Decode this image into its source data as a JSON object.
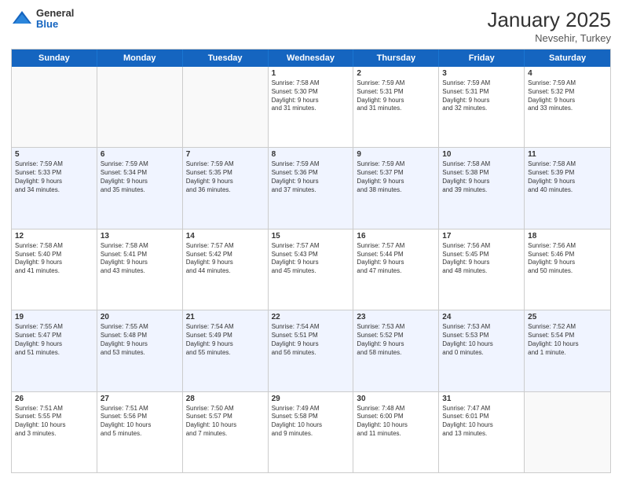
{
  "header": {
    "logo_general": "General",
    "logo_blue": "Blue",
    "month": "January 2025",
    "location": "Nevsehir, Turkey"
  },
  "days_of_week": [
    "Sunday",
    "Monday",
    "Tuesday",
    "Wednesday",
    "Thursday",
    "Friday",
    "Saturday"
  ],
  "weeks": [
    [
      {
        "day": "",
        "text": ""
      },
      {
        "day": "",
        "text": ""
      },
      {
        "day": "",
        "text": ""
      },
      {
        "day": "1",
        "text": "Sunrise: 7:58 AM\nSunset: 5:30 PM\nDaylight: 9 hours\nand 31 minutes."
      },
      {
        "day": "2",
        "text": "Sunrise: 7:59 AM\nSunset: 5:31 PM\nDaylight: 9 hours\nand 31 minutes."
      },
      {
        "day": "3",
        "text": "Sunrise: 7:59 AM\nSunset: 5:31 PM\nDaylight: 9 hours\nand 32 minutes."
      },
      {
        "day": "4",
        "text": "Sunrise: 7:59 AM\nSunset: 5:32 PM\nDaylight: 9 hours\nand 33 minutes."
      }
    ],
    [
      {
        "day": "5",
        "text": "Sunrise: 7:59 AM\nSunset: 5:33 PM\nDaylight: 9 hours\nand 34 minutes."
      },
      {
        "day": "6",
        "text": "Sunrise: 7:59 AM\nSunset: 5:34 PM\nDaylight: 9 hours\nand 35 minutes."
      },
      {
        "day": "7",
        "text": "Sunrise: 7:59 AM\nSunset: 5:35 PM\nDaylight: 9 hours\nand 36 minutes."
      },
      {
        "day": "8",
        "text": "Sunrise: 7:59 AM\nSunset: 5:36 PM\nDaylight: 9 hours\nand 37 minutes."
      },
      {
        "day": "9",
        "text": "Sunrise: 7:59 AM\nSunset: 5:37 PM\nDaylight: 9 hours\nand 38 minutes."
      },
      {
        "day": "10",
        "text": "Sunrise: 7:58 AM\nSunset: 5:38 PM\nDaylight: 9 hours\nand 39 minutes."
      },
      {
        "day": "11",
        "text": "Sunrise: 7:58 AM\nSunset: 5:39 PM\nDaylight: 9 hours\nand 40 minutes."
      }
    ],
    [
      {
        "day": "12",
        "text": "Sunrise: 7:58 AM\nSunset: 5:40 PM\nDaylight: 9 hours\nand 41 minutes."
      },
      {
        "day": "13",
        "text": "Sunrise: 7:58 AM\nSunset: 5:41 PM\nDaylight: 9 hours\nand 43 minutes."
      },
      {
        "day": "14",
        "text": "Sunrise: 7:57 AM\nSunset: 5:42 PM\nDaylight: 9 hours\nand 44 minutes."
      },
      {
        "day": "15",
        "text": "Sunrise: 7:57 AM\nSunset: 5:43 PM\nDaylight: 9 hours\nand 45 minutes."
      },
      {
        "day": "16",
        "text": "Sunrise: 7:57 AM\nSunset: 5:44 PM\nDaylight: 9 hours\nand 47 minutes."
      },
      {
        "day": "17",
        "text": "Sunrise: 7:56 AM\nSunset: 5:45 PM\nDaylight: 9 hours\nand 48 minutes."
      },
      {
        "day": "18",
        "text": "Sunrise: 7:56 AM\nSunset: 5:46 PM\nDaylight: 9 hours\nand 50 minutes."
      }
    ],
    [
      {
        "day": "19",
        "text": "Sunrise: 7:55 AM\nSunset: 5:47 PM\nDaylight: 9 hours\nand 51 minutes."
      },
      {
        "day": "20",
        "text": "Sunrise: 7:55 AM\nSunset: 5:48 PM\nDaylight: 9 hours\nand 53 minutes."
      },
      {
        "day": "21",
        "text": "Sunrise: 7:54 AM\nSunset: 5:49 PM\nDaylight: 9 hours\nand 55 minutes."
      },
      {
        "day": "22",
        "text": "Sunrise: 7:54 AM\nSunset: 5:51 PM\nDaylight: 9 hours\nand 56 minutes."
      },
      {
        "day": "23",
        "text": "Sunrise: 7:53 AM\nSunset: 5:52 PM\nDaylight: 9 hours\nand 58 minutes."
      },
      {
        "day": "24",
        "text": "Sunrise: 7:53 AM\nSunset: 5:53 PM\nDaylight: 10 hours\nand 0 minutes."
      },
      {
        "day": "25",
        "text": "Sunrise: 7:52 AM\nSunset: 5:54 PM\nDaylight: 10 hours\nand 1 minute."
      }
    ],
    [
      {
        "day": "26",
        "text": "Sunrise: 7:51 AM\nSunset: 5:55 PM\nDaylight: 10 hours\nand 3 minutes."
      },
      {
        "day": "27",
        "text": "Sunrise: 7:51 AM\nSunset: 5:56 PM\nDaylight: 10 hours\nand 5 minutes."
      },
      {
        "day": "28",
        "text": "Sunrise: 7:50 AM\nSunset: 5:57 PM\nDaylight: 10 hours\nand 7 minutes."
      },
      {
        "day": "29",
        "text": "Sunrise: 7:49 AM\nSunset: 5:58 PM\nDaylight: 10 hours\nand 9 minutes."
      },
      {
        "day": "30",
        "text": "Sunrise: 7:48 AM\nSunset: 6:00 PM\nDaylight: 10 hours\nand 11 minutes."
      },
      {
        "day": "31",
        "text": "Sunrise: 7:47 AM\nSunset: 6:01 PM\nDaylight: 10 hours\nand 13 minutes."
      },
      {
        "day": "",
        "text": ""
      }
    ]
  ]
}
